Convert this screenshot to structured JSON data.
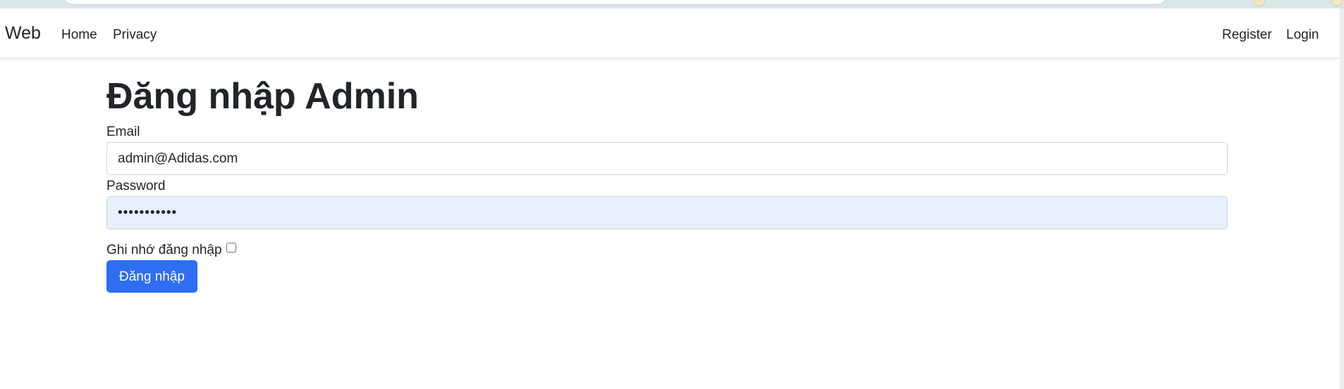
{
  "navbar": {
    "brand": "Web",
    "links": [
      "Home",
      "Privacy"
    ],
    "right_links": [
      "Register",
      "Login"
    ]
  },
  "page": {
    "title": "Đăng nhập Admin"
  },
  "form": {
    "email": {
      "label": "Email",
      "value": "admin@Adidas.com"
    },
    "password": {
      "label": "Password",
      "masked_value": "•••••••••••"
    },
    "remember": {
      "label": "Ghi nhớ đăng nhập",
      "checked": false
    },
    "submit_label": "Đăng nhập"
  },
  "colors": {
    "primary_button": "#2f6df3",
    "autofill_background": "#e8f0fe",
    "text": "#212529",
    "browser_chrome": "#dae7ea"
  }
}
